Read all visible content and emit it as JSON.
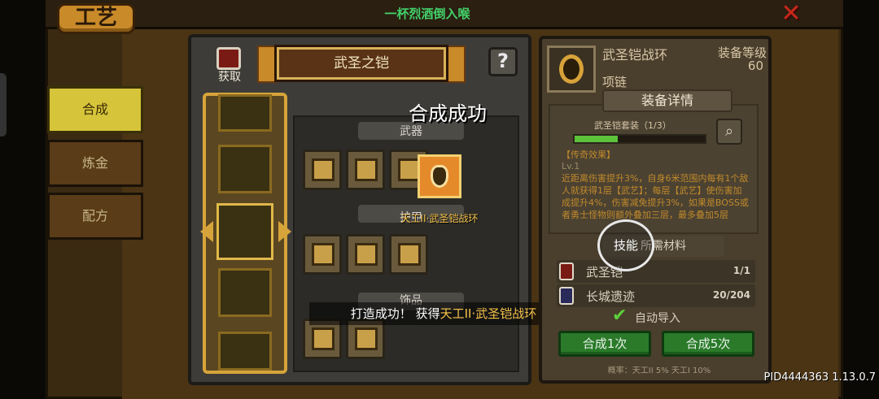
{
  "header": {
    "tab_title": "工艺",
    "banner": "一杯烈酒倒入喉"
  },
  "side_tabs": [
    {
      "label": "合成",
      "active": true
    },
    {
      "label": "炼金",
      "active": false
    },
    {
      "label": "配方",
      "active": false
    }
  ],
  "middle": {
    "fetch_label": "获取",
    "title": "武圣之铠",
    "help": "?",
    "sections": {
      "weapon": "武器",
      "armor": "护甲",
      "accessory": "饰品"
    }
  },
  "popup": {
    "title": "合成成功",
    "result_name": "天工II·武圣铠战环",
    "toast_prefix": "打造成功！ 获得",
    "toast_item": "天工II·武圣铠战环"
  },
  "equipment": {
    "name": "武圣铠战环",
    "type": "项链",
    "level_label": "装备等级",
    "level": "60",
    "detail_header": "装备详情",
    "set_label": "武圣铠套装（1/3）",
    "set_progress": 0.33,
    "legend_title": "【传奇效果】",
    "legend_lv": "Lv.1",
    "legend_text": "近距离伤害提升3%，自身6米范围内每有1个敌人就获得1层【武艺】；每层【武艺】使伤害加成提升4%，伤害减免提升3%，如果是BOSS或者勇士怪物则额外叠加三层，最多叠加5层"
  },
  "materials": {
    "header": "所需材料",
    "items": [
      {
        "name": "武圣铠",
        "count": "1/1",
        "icon": "card-icon"
      },
      {
        "name": "长城遗迹",
        "count": "20/204",
        "icon": "book-icon"
      }
    ],
    "auto_import": "自动导入"
  },
  "buttons": {
    "craft1": "合成1次",
    "craft5": "合成5次",
    "skill": "技能"
  },
  "probability": "概率：天工II 5% 天工I 10%",
  "pid": "PID4444363 1.13.0.7",
  "colors": {
    "accent_gold": "#d6a43a",
    "success_green": "#2a7a2a",
    "highlight": "#f6c24a"
  }
}
